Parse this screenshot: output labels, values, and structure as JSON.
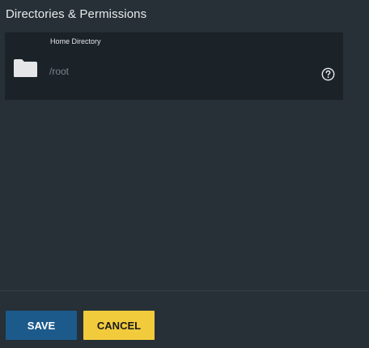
{
  "section": {
    "title": "Directories & Permissions"
  },
  "home_directory": {
    "label": "Home Directory",
    "placeholder": "/root",
    "icon": "folder-icon",
    "help_icon": "help-circle-icon"
  },
  "actions": {
    "save_label": "SAVE",
    "cancel_label": "CANCEL"
  },
  "colors": {
    "background": "#263036",
    "card": "#1b2228",
    "primary": "#1c5a8c",
    "secondary": "#f2cb3d"
  }
}
